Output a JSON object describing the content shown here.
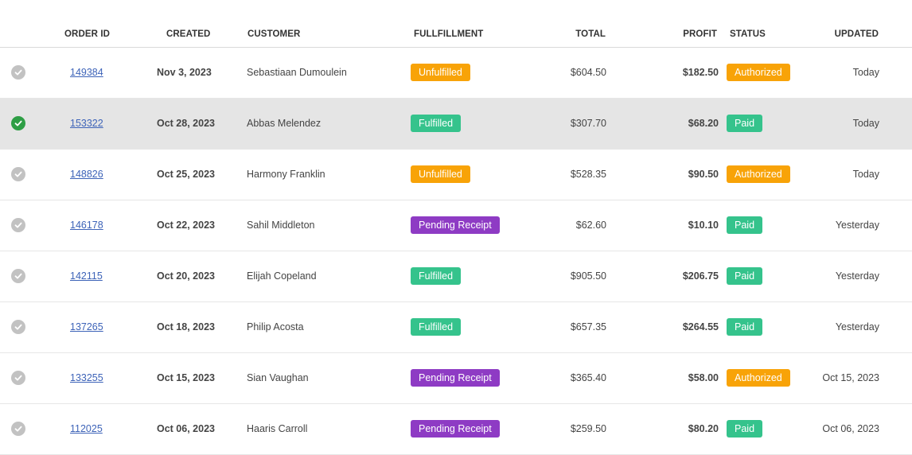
{
  "headers": {
    "order_id": "ORDER ID",
    "created": "CREATED",
    "customer": "CUSTOMER",
    "fulfillment": "FULLFILLMENT",
    "total": "TOTAL",
    "profit": "PROFIT",
    "status": "STATUS",
    "updated": "UPDATED"
  },
  "colors": {
    "unfulfilled": "#f8a308",
    "fulfilled": "#35c38c",
    "pending_receipt": "#8e3bc4",
    "authorized": "#f8a308",
    "paid": "#35c38c",
    "link": "#3d63b8",
    "selected_row": "#e5e5e5",
    "check_selected": "#2e9e45",
    "check_default": "#c2c2c2"
  },
  "rows": [
    {
      "selected": false,
      "order_id": "149384",
      "created": "Nov 3, 2023",
      "customer": "Sebastiaan Dumoulein",
      "fulfillment": "Unfulfilled",
      "fulfillment_kind": "unfulfilled",
      "total": "$604.50",
      "profit": "$182.50",
      "status": "Authorized",
      "status_kind": "authorized",
      "updated": "Today"
    },
    {
      "selected": true,
      "order_id": "153322",
      "created": "Oct 28, 2023",
      "customer": "Abbas Melendez",
      "fulfillment": "Fulfilled",
      "fulfillment_kind": "fulfilled",
      "total": "$307.70",
      "profit": "$68.20",
      "status": "Paid",
      "status_kind": "paid",
      "updated": "Today"
    },
    {
      "selected": false,
      "order_id": "148826",
      "created": "Oct 25, 2023",
      "customer": "Harmony Franklin",
      "fulfillment": "Unfulfilled",
      "fulfillment_kind": "unfulfilled",
      "total": "$528.35",
      "profit": "$90.50",
      "status": "Authorized",
      "status_kind": "authorized",
      "updated": "Today"
    },
    {
      "selected": false,
      "order_id": "146178",
      "created": "Oct 22, 2023",
      "customer": "Sahil Middleton",
      "fulfillment": "Pending Receipt",
      "fulfillment_kind": "pending",
      "total": "$62.60",
      "profit": "$10.10",
      "status": "Paid",
      "status_kind": "paid",
      "updated": "Yesterday"
    },
    {
      "selected": false,
      "order_id": "142115",
      "created": "Oct 20, 2023",
      "customer": "Elijah Copeland",
      "fulfillment": "Fulfilled",
      "fulfillment_kind": "fulfilled",
      "total": "$905.50",
      "profit": "$206.75",
      "status": "Paid",
      "status_kind": "paid",
      "updated": "Yesterday"
    },
    {
      "selected": false,
      "order_id": "137265",
      "created": "Oct 18, 2023",
      "customer": "Philip Acosta",
      "fulfillment": "Fulfilled",
      "fulfillment_kind": "fulfilled",
      "total": "$657.35",
      "profit": "$264.55",
      "status": "Paid",
      "status_kind": "paid",
      "updated": "Yesterday"
    },
    {
      "selected": false,
      "order_id": "133255",
      "created": "Oct 15, 2023",
      "customer": "Sian Vaughan",
      "fulfillment": "Pending Receipt",
      "fulfillment_kind": "pending",
      "total": "$365.40",
      "profit": "$58.00",
      "status": "Authorized",
      "status_kind": "authorized",
      "updated": "Oct 15, 2023"
    },
    {
      "selected": false,
      "order_id": "112025",
      "created": "Oct 06, 2023",
      "customer": "Haaris Carroll",
      "fulfillment": "Pending Receipt",
      "fulfillment_kind": "pending",
      "total": "$259.50",
      "profit": "$80.20",
      "status": "Paid",
      "status_kind": "paid",
      "updated": "Oct 06, 2023"
    }
  ]
}
